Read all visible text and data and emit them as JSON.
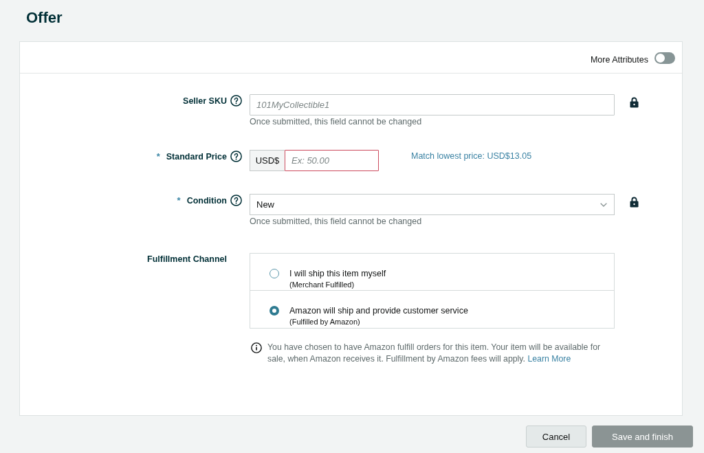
{
  "page_title": "Offer",
  "more_attributes": {
    "label": "More Attributes",
    "on": false
  },
  "fields": [
    {
      "kind": "text",
      "label": "Seller SKU",
      "help": true,
      "placeholder": "101MyCollectible1",
      "note": "Once submitted, this field cannot be changed",
      "locked": true
    },
    {
      "kind": "price",
      "required_mark": "*",
      "label": "Standard Price",
      "help": true,
      "currency": "USD$",
      "placeholder": "Ex: 50.00",
      "invalid": true,
      "hint_link": "Match lowest price: USD$13.05",
      "locked": false
    },
    {
      "kind": "select",
      "required_mark": "*",
      "label": "Condition",
      "help": true,
      "value": "New",
      "note": "Once submitted, this field cannot be changed",
      "locked": true
    },
    {
      "kind": "radio",
      "label": "Fulfillment Channel",
      "help": false,
      "locked": false,
      "options": [
        {
          "label": "I will ship this item myself",
          "sublabel": "(Merchant Fulfilled)",
          "selected": false
        },
        {
          "label": "Amazon will ship and provide customer service",
          "sublabel": "(Fulfilled by Amazon)",
          "selected": true
        }
      ],
      "info": {
        "text": "You have chosen to have Amazon fulfill orders for this item. Your item will be available for sale, when Amazon receives it. Fulfillment by Amazon fees will apply.",
        "link": "Learn More"
      }
    }
  ],
  "buttons": [
    {
      "label": "Cancel",
      "kind": "secondary",
      "disabled": false
    },
    {
      "label": "Save and finish",
      "kind": "primary",
      "disabled": true
    }
  ]
}
